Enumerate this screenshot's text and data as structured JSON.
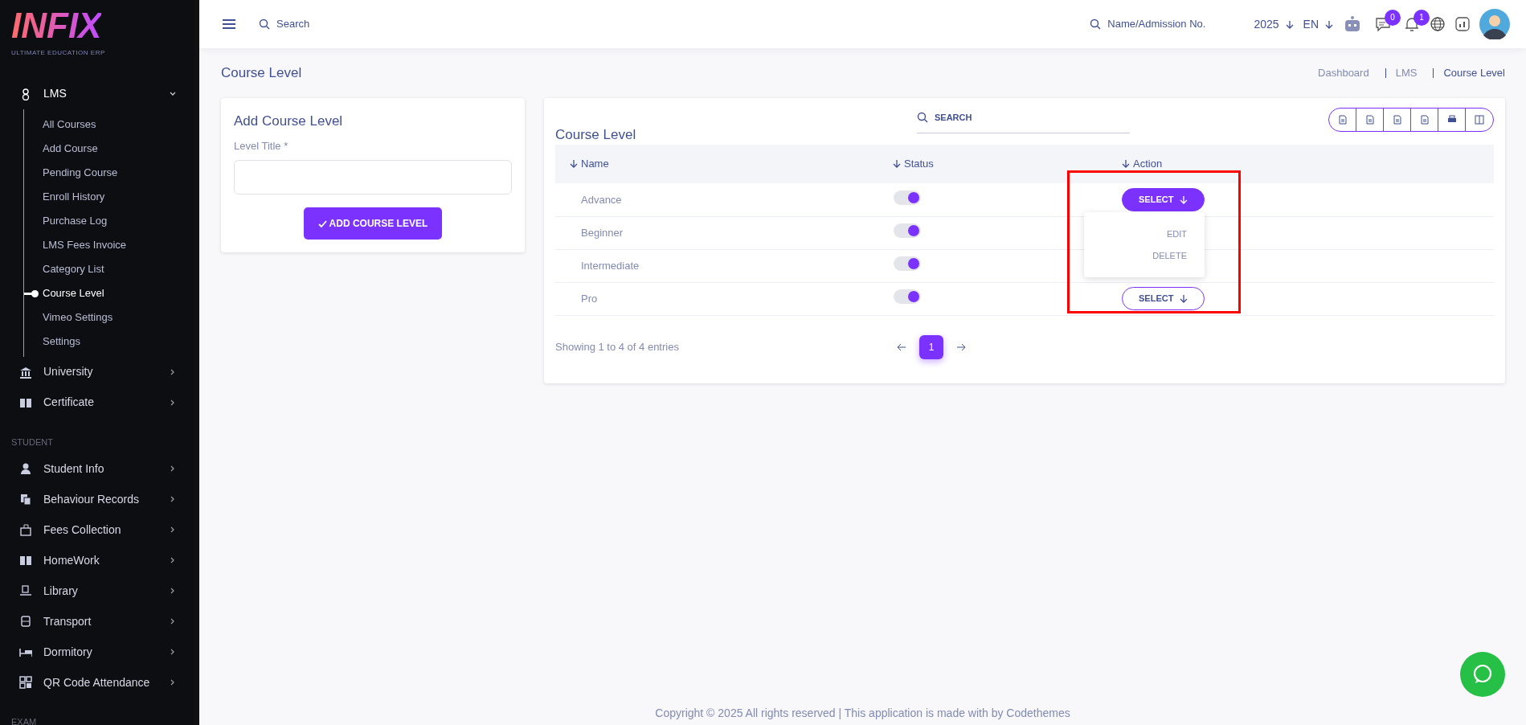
{
  "sidebar": {
    "logo": {
      "word": "INFIX",
      "tagline": "ULTIMATE EDUCATION ERP"
    },
    "groups": [
      {
        "items": [
          {
            "label": "LMS",
            "expanded": true,
            "children": [
              {
                "label": "All Courses",
                "selected": false
              },
              {
                "label": "Add Course",
                "selected": false
              },
              {
                "label": "Pending Course",
                "selected": false
              },
              {
                "label": "Enroll History",
                "selected": false
              },
              {
                "label": "Purchase Log",
                "selected": false
              },
              {
                "label": "LMS Fees Invoice",
                "selected": false
              },
              {
                "label": "Category List",
                "selected": false
              },
              {
                "label": "Course Level",
                "selected": true
              },
              {
                "label": "Vimeo Settings",
                "selected": false
              },
              {
                "label": "Settings",
                "selected": false
              }
            ]
          },
          {
            "label": "University",
            "expanded": false
          },
          {
            "label": "Certificate",
            "expanded": false
          }
        ]
      },
      {
        "heading": "STUDENT",
        "items": [
          {
            "label": "Student Info",
            "expanded": false
          },
          {
            "label": "Behaviour Records",
            "expanded": false
          },
          {
            "label": "Fees Collection",
            "expanded": false
          },
          {
            "label": "HomeWork",
            "expanded": false
          },
          {
            "label": "Library",
            "expanded": false
          },
          {
            "label": "Transport",
            "expanded": false
          },
          {
            "label": "Dormitory",
            "expanded": false
          },
          {
            "label": "QR Code Attendance",
            "expanded": false
          }
        ]
      },
      {
        "heading": "EXAM"
      }
    ]
  },
  "topbar": {
    "search_placeholder": "Search",
    "student_search_placeholder": "Name/Admission No.",
    "year": "2025",
    "language": "EN",
    "messages_count": "0",
    "notifications_count": "1"
  },
  "page": {
    "title": "Course Level",
    "breadcrumb": [
      "Dashboard",
      "LMS",
      "Course Level"
    ]
  },
  "form": {
    "title": "Add Course Level",
    "field_label": "Level Title *",
    "submit": "ADD COURSE LEVEL"
  },
  "table": {
    "title": "Course Level",
    "search_placeholder": "SEARCH",
    "columns": [
      "Name",
      "Status",
      "Action"
    ],
    "rows": [
      {
        "name": "Advance",
        "on": true,
        "action": "SELECT",
        "open": true
      },
      {
        "name": "Beginner",
        "on": true,
        "open": false
      },
      {
        "name": "Intermediate",
        "on": true,
        "open": false
      },
      {
        "name": "Pro",
        "on": true,
        "action": "SELECT",
        "open": false
      }
    ],
    "menu": [
      "EDIT",
      "DELETE"
    ],
    "info": "Showing 1 to 4 of 4 entries",
    "pages": [
      {
        "label": "1",
        "selected": true
      }
    ]
  },
  "footer": "Copyright © 2025 All rights reserved | This application is made with by Codethemes"
}
